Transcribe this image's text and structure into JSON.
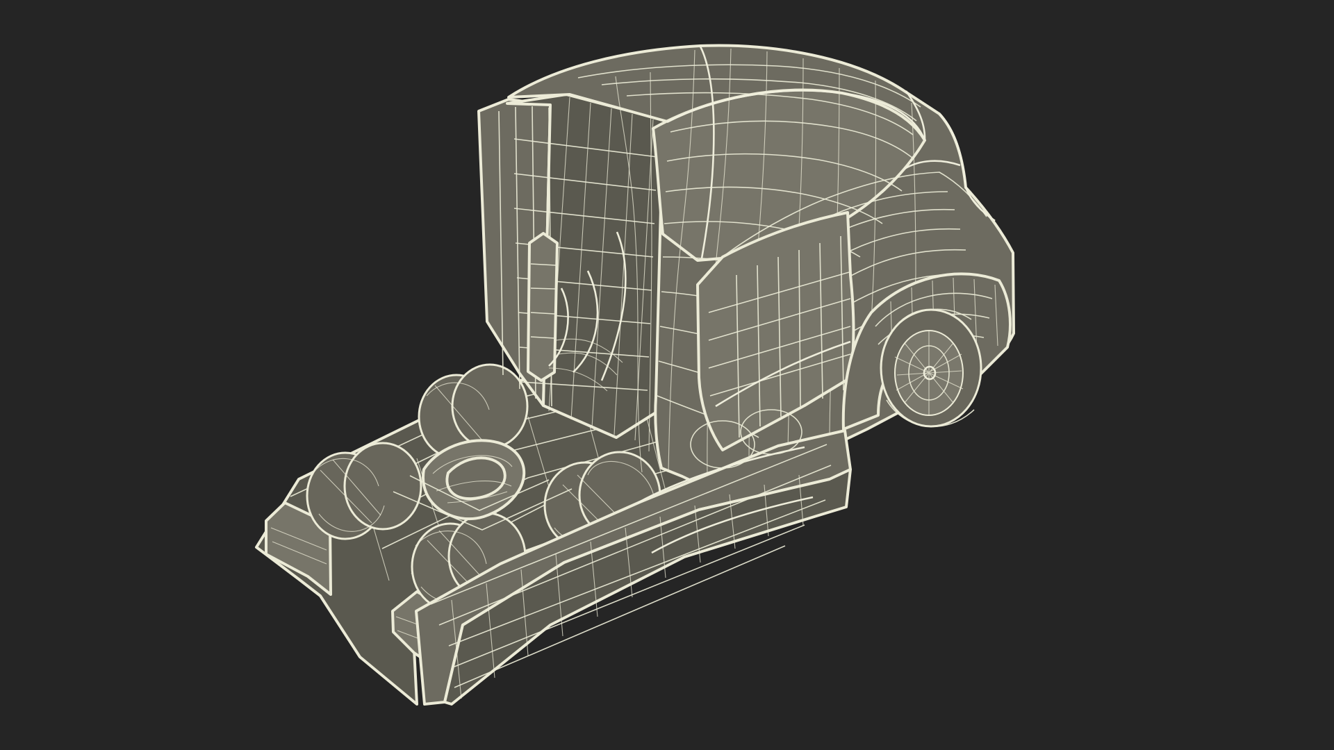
{
  "scene": {
    "subject": "semi-truck-cab-wireframe",
    "background_color": "#252525",
    "wire_color": "#ecebd7",
    "surface_color": "#6d6b60"
  }
}
